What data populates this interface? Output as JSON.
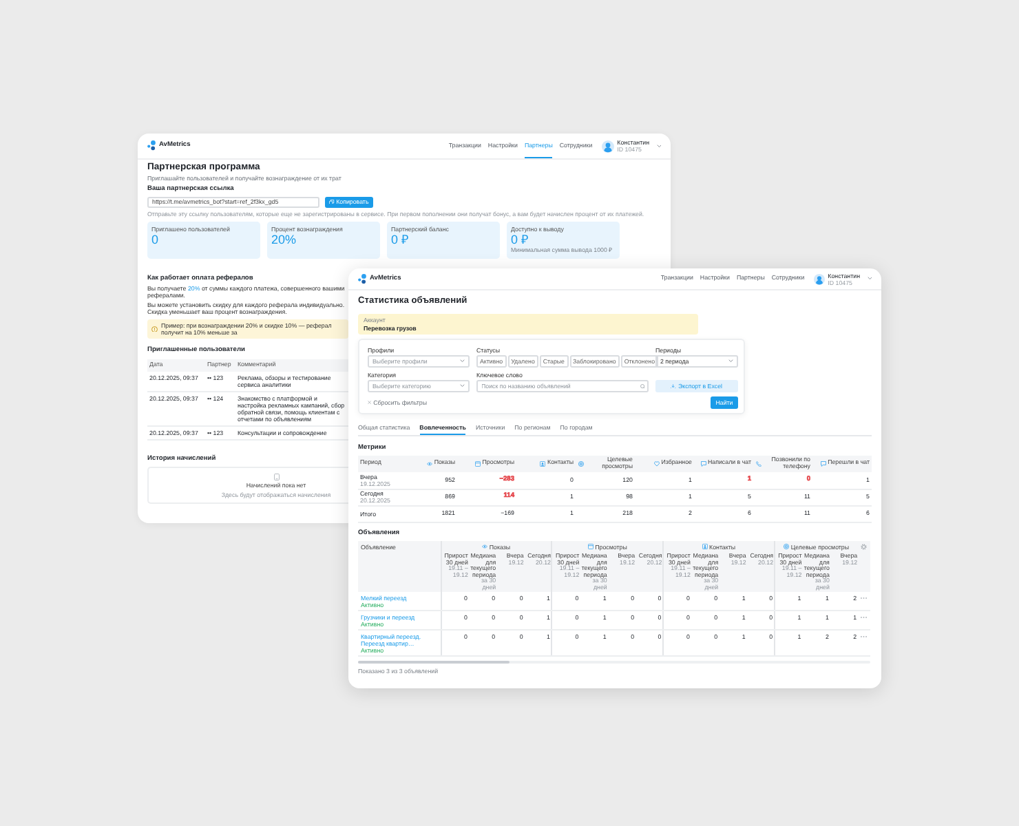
{
  "back_window": {
    "header": {
      "logo": "AvMetrics",
      "nav": [
        {
          "label": "Транзакции",
          "selected": false
        },
        {
          "label": "Настройки",
          "selected": false
        },
        {
          "label": "Партнеры",
          "selected": true
        },
        {
          "label": "Сотрудники",
          "selected": false
        }
      ],
      "user": {
        "name": "Константин",
        "id": "ID 10475"
      }
    },
    "title": "Партнерская программа",
    "subtitle": "Приглашайте пользователей и получайте вознаграждение от их трат",
    "referral": {
      "heading": "Ваша партнерская ссылка",
      "link": "https://t.me/avmetrics_bot?start=ref_2f3kx_gd5",
      "button": "Копировать",
      "hint": "Отправьте эту ссылку пользователям, которые еще не зарегистрированы в сервисе. При первом пополнении они получат бонус, а вам будет начислен процент от их платежей."
    },
    "stats": [
      {
        "label": "Приглашено пользователей",
        "value": "0"
      },
      {
        "label": "Процент вознаграждения",
        "value": "20%"
      },
      {
        "label": "Партнерский баланс",
        "value": "0 ₽"
      },
      {
        "label": "Доступно к выводу",
        "value": "0 ₽",
        "note": "Минимальная сумма вывода 1000 ₽"
      }
    ],
    "how_it_works": {
      "heading": "Как работает оплата рефералов",
      "paragraphs": [
        "Вы получаете **20%** от суммы каждого платежа, совершенного вашими рефералами.",
        "Вы можете установить скидку для каждого реферала индивидуально. Скидка уменьшает ваш процент вознаграждения."
      ],
      "warning": "Пример: при вознаграждении 20% и скидке 10% — реферал получит на 10% меньше за"
    },
    "invited": {
      "heading": "Приглашенные пользователи",
      "columns": [
        "Дата",
        "Партнер",
        "Комментарий"
      ],
      "rows": [
        {
          "cells": [
            "20.12.2025, 09:37",
            "•• 123",
            "Реклама, обзоры и тестирование сервиса аналитики"
          ]
        },
        {
          "cells": [
            "20.12.2025, 09:37",
            "•• 124",
            "Знакомство с платформой и настройка рекламных кампаний, сбор обратной связи, помощь клиентам с отчетами по объявлениям"
          ]
        },
        {
          "cells": [
            "20.12.2025, 09:37",
            "•• 123",
            "Консультации и сопровождение"
          ]
        }
      ]
    },
    "history": {
      "heading": "История начислений",
      "empty_title": "Начислений пока нет",
      "empty_text": "Здесь будут отображаться начисления"
    }
  },
  "front_window": {
    "header": {
      "logo": "AvMetrics",
      "nav": [
        {
          "label": "Транзакции",
          "selected": false
        },
        {
          "label": "Настройки",
          "selected": false
        },
        {
          "label": "Партнеры",
          "selected": false
        },
        {
          "label": "Сотрудники",
          "selected": false
        }
      ],
      "user": {
        "name": "Константин",
        "id": "ID 10475"
      }
    },
    "title": "Статистика объявлений",
    "account": {
      "label": "Аккаунт",
      "value": "Перевозка грузов"
    },
    "filters": {
      "profile": {
        "label": "Профили",
        "placeholder": "Выберите профили"
      },
      "statuses": {
        "label": "Статусы",
        "options": [
          {
            "label": "Активно",
            "selected": false
          },
          {
            "label": "Удалено",
            "selected": false
          },
          {
            "label": "Старые",
            "selected": false
          },
          {
            "label": "Заблокировано",
            "selected": false
          },
          {
            "label": "Отклонено",
            "selected": false
          }
        ]
      },
      "period": {
        "label": "Периоды",
        "value": "2 периода"
      },
      "category": {
        "label": "Категория",
        "placeholder": "Выберите категорию"
      },
      "keyword": {
        "label": "Ключевое слово",
        "placeholder": "Поиск по названию объявлений"
      },
      "export_button": "Экспорт в Excel",
      "reset": "Сбросить фильтры",
      "search_button": "Найти"
    },
    "tabs": [
      {
        "label": "Общая статистика",
        "selected": false
      },
      {
        "label": "Вовлеченность",
        "selected": true
      },
      {
        "label": "Источники",
        "selected": false
      },
      {
        "label": "По регионам",
        "selected": false
      },
      {
        "label": "По городам",
        "selected": false
      }
    ],
    "metrics": {
      "heading": "Метрики",
      "columns": [
        "Период",
        "Показы",
        "Просмотры",
        "Контакты",
        "Целевые просмотры",
        "Избранное",
        "Написали в чат",
        "Позвонили по телефону",
        "Перешли в чат"
      ],
      "rows": [
        {
          "cells": [
            {
              "text": "Вчера",
              "date": "19.12.2025"
            },
            "952",
            {
              "text": "−283",
              "color": "#e5484d"
            },
            "0",
            "120",
            "1",
            {
              "text": "1",
              "color": "#e5484d"
            },
            {
              "text": "0",
              "color": "#e5484d"
            },
            "1"
          ]
        },
        {
          "cells": [
            {
              "text": "Сегодня",
              "date": "20.12.2025"
            },
            "869",
            {
              "text": "114",
              "color": "#e5484d"
            },
            "1",
            "98",
            "1",
            "5",
            "11",
            "5"
          ]
        },
        {
          "cells": [
            "Итого",
            "1821",
            "−169",
            "1",
            "218",
            "2",
            "6",
            "11",
            "6"
          ]
        }
      ]
    },
    "ads": {
      "heading": "Объявления",
      "first_column": "Объявление",
      "groups": [
        {
          "label": "Показы",
          "subcolumns": [
            {
              "label": "Прирост 30 дней",
              "note": "19.11 – 19.12"
            },
            {
              "label": "Медиана для текущего периода",
              "note": "за 30 дней"
            },
            {
              "label": "Вчера",
              "note": "19.12"
            },
            {
              "label": "Сегодня",
              "note": "20.12"
            }
          ]
        },
        {
          "label": "Просмотры",
          "subcolumns": [
            {
              "label": "Прирост 30 дней",
              "note": "19.11 – 19.12"
            },
            {
              "label": "Медиана для текущего периода",
              "note": "за 30 дней"
            },
            {
              "label": "Вчера",
              "note": "19.12"
            },
            {
              "label": "Сегодня",
              "note": "20.12"
            }
          ]
        },
        {
          "label": "Контакты",
          "subcolumns": [
            {
              "label": "Прирост 30 дней",
              "note": "19.11 – 19.12"
            },
            {
              "label": "Медиана для текущего периода",
              "note": "за 30 дней"
            },
            {
              "label": "Вчера",
              "note": "19.12"
            },
            {
              "label": "Сегодня",
              "note": "20.12"
            }
          ]
        },
        {
          "label": "Целевые просмотры",
          "subcolumns": [
            {
              "label": "Прирост 30 дней",
              "note": "19.11 – 19.12"
            },
            {
              "label": "Медиана для текущего периода",
              "note": "за 30 дней"
            },
            {
              "label": "Вчера",
              "note": "19.12"
            }
          ]
        }
      ],
      "rows": [
        {
          "cells": [
            {
              "text": "Мелкий переезд",
              "status": "Активно"
            },
            "0",
            "0",
            "0",
            "1",
            "0",
            "1",
            "0",
            "0",
            "0",
            "0",
            "1",
            "0",
            "1",
            "1",
            "2"
          ]
        },
        {
          "cells": [
            {
              "text": "Грузчики и переезд",
              "status": "Активно"
            },
            "0",
            "0",
            "0",
            "1",
            "0",
            "1",
            "0",
            "0",
            "0",
            "0",
            "1",
            "0",
            "1",
            "1",
            "1"
          ]
        },
        {
          "cells": [
            {
              "text": "Квартирный переезд. Переезд квартир…",
              "status": "Активно"
            },
            "0",
            "0",
            "0",
            "1",
            "0",
            "1",
            "0",
            "0",
            "0",
            "0",
            "1",
            "0",
            "1",
            "2",
            "2"
          ]
        }
      ],
      "footer": "Показано 3 из 3 объявлений"
    }
  }
}
